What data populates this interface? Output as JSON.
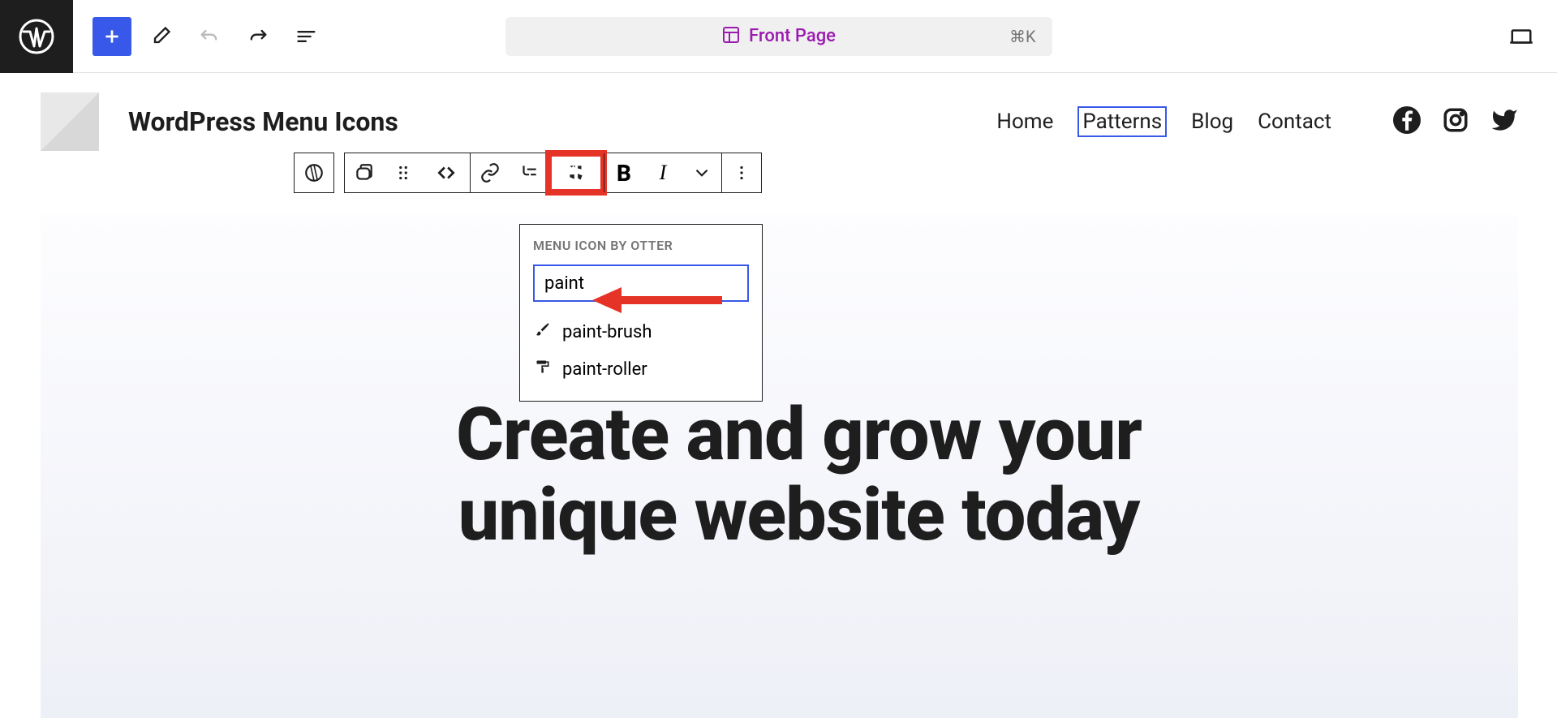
{
  "topbar": {
    "cmd_shortcut": "⌘K",
    "doc_title": "Front Page"
  },
  "site": {
    "title": "WordPress Menu Icons"
  },
  "nav": {
    "items": [
      {
        "label": "Home",
        "selected": false
      },
      {
        "label": "Patterns",
        "selected": true
      },
      {
        "label": "Blog",
        "selected": false
      },
      {
        "label": "Contact",
        "selected": false
      }
    ]
  },
  "toolbar": {
    "bold": "B",
    "italic": "I"
  },
  "popover": {
    "title": "MENU ICON BY OTTER",
    "search_value": "paint",
    "results": [
      {
        "name": "paint-brush",
        "icon": "paint-brush-icon"
      },
      {
        "name": "paint-roller",
        "icon": "paint-roller-icon"
      }
    ]
  },
  "hero": {
    "line1": "Create and grow your",
    "line2": "unique website today"
  }
}
